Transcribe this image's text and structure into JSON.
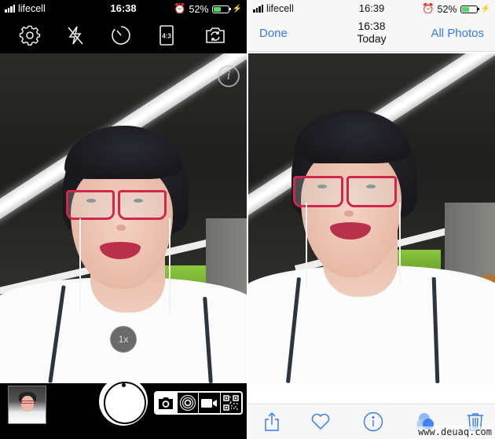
{
  "left_screen": {
    "status_bar": {
      "carrier": "lifecell",
      "time": "16:38",
      "battery": "52%",
      "battery_level": 0.52
    },
    "camera_toolbar": [
      {
        "name": "settings",
        "icon": "gear-icon"
      },
      {
        "name": "flash-off",
        "icon": "flash-off-icon"
      },
      {
        "name": "timer",
        "icon": "timer-icon"
      },
      {
        "name": "aspect-ratio",
        "icon": "aspect-ratio-icon",
        "label": "4:3"
      },
      {
        "name": "switch-camera",
        "icon": "switch-camera-icon"
      }
    ],
    "info_button": {
      "icon": "info-icon",
      "label": "i"
    },
    "zoom_button": {
      "label": "1x"
    },
    "bottom_bar": {
      "thumbnail": "last-photo-thumbnail",
      "shutter": "shutter-button",
      "modes": [
        {
          "name": "photo",
          "icon": "camera-icon",
          "active": true
        },
        {
          "name": "live",
          "icon": "live-photo-icon",
          "active": false
        },
        {
          "name": "video",
          "icon": "video-icon",
          "active": false
        },
        {
          "name": "qr",
          "icon": "qr-code-icon",
          "active": false
        }
      ]
    }
  },
  "right_screen": {
    "status_bar": {
      "carrier": "lifecell",
      "time": "16:39",
      "battery": "52%",
      "battery_level": 0.52
    },
    "nav": {
      "done_label": "Done",
      "title_time": "16:38",
      "title_day": "Today",
      "all_photos_label": "All Photos"
    },
    "toolbar": [
      {
        "name": "share",
        "icon": "share-icon"
      },
      {
        "name": "favorite",
        "icon": "heart-icon"
      },
      {
        "name": "info",
        "icon": "info-icon"
      },
      {
        "name": "effects",
        "icon": "live-effects-icon"
      },
      {
        "name": "delete",
        "icon": "trash-icon"
      }
    ],
    "accent_color": "#3478f6"
  },
  "watermark": "www.deuaq.com"
}
